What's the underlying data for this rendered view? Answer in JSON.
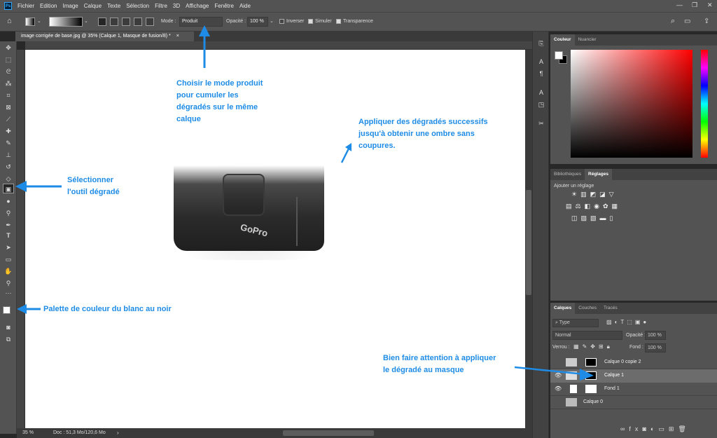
{
  "menu": {
    "logo": "Ps",
    "items": [
      "Fichier",
      "Edition",
      "Image",
      "Calque",
      "Texte",
      "Sélection",
      "Filtre",
      "3D",
      "Affichage",
      "Fenêtre",
      "Aide"
    ]
  },
  "options": {
    "mode_label": "Mode :",
    "mode_value": "Produit",
    "opacity_label": "Opacité :",
    "opacity_value": "100 %",
    "invert_label": "Inverser",
    "simulate_label": "Simuler",
    "transparency_label": "Transparence"
  },
  "document": {
    "tab_title": "image corrigée de base.jpg @ 35% (Calque 1, Masque de fusion/8) *",
    "zoom": "35 %",
    "doc_info": "Doc : 51,3 Mo/120,6 Mo"
  },
  "color_panel": {
    "tabs": [
      "Couleur",
      "Nuancier"
    ]
  },
  "adjust_panel": {
    "tabs": [
      "Bibliothèques",
      "Réglages"
    ],
    "add_label": "Ajouter un réglage"
  },
  "layers_panel": {
    "tabs": [
      "Calques",
      "Couches",
      "Tracés"
    ],
    "filter_label": "Type",
    "blend_mode": "Normal",
    "opacity_label": "Opacité :",
    "opacity_value": "100 %",
    "lock_label": "Verrou :",
    "fill_label": "Fond :",
    "fill_value": "100 %",
    "layers": [
      {
        "name": "Calque 0 copie 2",
        "visible": false,
        "selected": false
      },
      {
        "name": "Calque 1",
        "visible": true,
        "selected": true
      },
      {
        "name": "Fond 1",
        "visible": true,
        "selected": false
      },
      {
        "name": "Calque 0",
        "visible": false,
        "selected": false
      }
    ]
  },
  "canvas": {
    "brand_text": "GoPro"
  },
  "annotations": {
    "mode": "Choisir le mode produit\npour cumuler les\ndégradés sur le même\ncalque",
    "gradients": "Appliquer des dégradés successifs\njusqu'à obtenir une ombre sans\ncoupures.",
    "tool": "Sélectionner\nl'outil dégradé",
    "palette": "Palette de couleur du blanc au noir",
    "mask": "Bien faire attention à appliquer\nle dégradé au masque"
  },
  "colors": {
    "annotation_blue": "#1e8ce6",
    "panel_bg": "#535353"
  }
}
